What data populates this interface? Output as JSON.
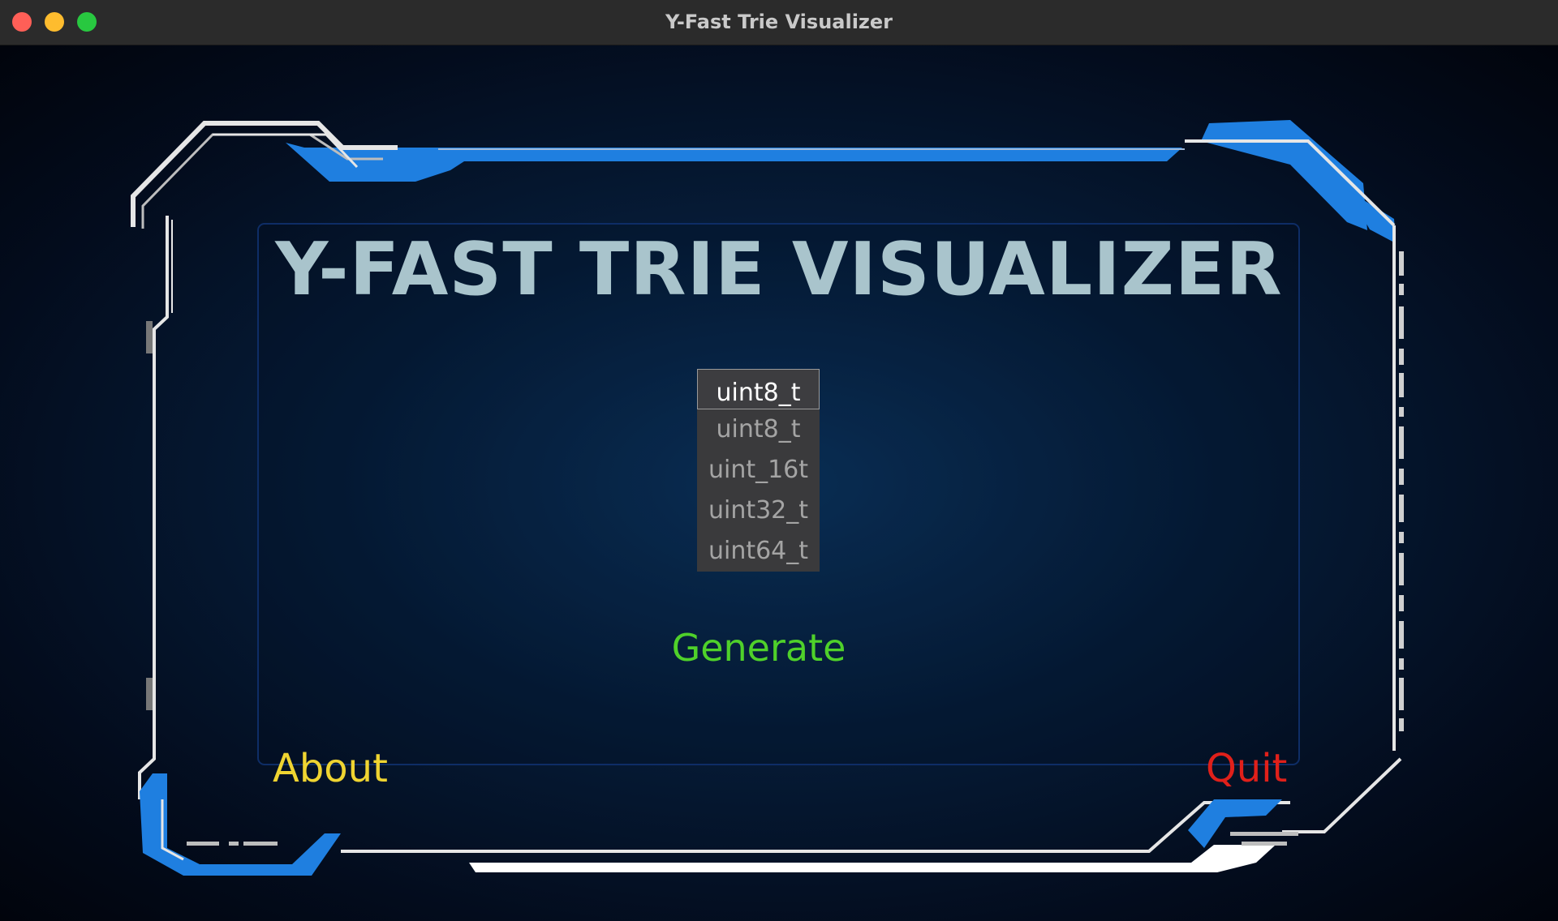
{
  "window": {
    "title": "Y-Fast Trie Visualizer"
  },
  "main": {
    "heading": "Y-FAST TRIE VISUALIZER",
    "type_dropdown": {
      "selected": "uint8_t",
      "options": [
        "uint8_t",
        "uint_16t",
        "uint32_t",
        "uint64_t"
      ]
    },
    "generate_label": "Generate",
    "about_label": "About",
    "quit_label": "Quit"
  },
  "colors": {
    "heading": "#a9c4cc",
    "generate": "#4fd12a",
    "about": "#efd431",
    "quit": "#e0201a",
    "frame_accent": "#1f7fe0",
    "frame_line": "#e6e6e6"
  }
}
